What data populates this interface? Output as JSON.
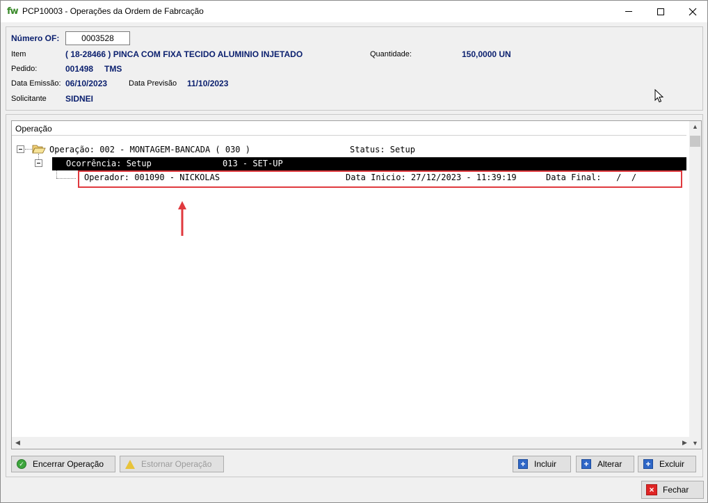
{
  "window": {
    "logo": "fw",
    "title": "PCP10003 - Operações da Ordem de Fabrcação"
  },
  "header": {
    "of_label": "Número OF:",
    "of_value": "0003528",
    "item_label": "Item",
    "item_value": "( 18-28466 ) PINCA COM FIXA TECIDO ALUMINIO INJETADO",
    "quantidade_label": "Quantidade:",
    "quantidade_value": "150,0000 UN",
    "pedido_label": "Pedido:",
    "pedido_value": "001498",
    "pedido_extra": "TMS",
    "emissao_label": "Data Emissão:",
    "emissao_value": "06/10/2023",
    "previsao_label": "Data Previsão",
    "previsao_value": "11/10/2023",
    "solicitante_label": "Solicitante",
    "solicitante_value": "SIDNEI"
  },
  "tree": {
    "header": "Operação",
    "operation_row": "Operação: 002 - MONTAGEM-BANCADA ( 030 )",
    "operation_status": "Status: Setup",
    "occurrence_row": "Ocorrência: Setup",
    "occurrence_code": "013 - SET-UP",
    "operator_row": "Operador: 001090 - NICKOLAS",
    "operator_inicio": "Data Inicio: 27/12/2023 - 11:39:19",
    "operator_final": "Data Final:   /  /"
  },
  "buttons": {
    "encerrar": "Encerrar Operação",
    "estornar": "Estornar Operação",
    "incluir": "Incluir",
    "alterar": "Alterar",
    "excluir": "Excluir",
    "fechar": "Fechar"
  },
  "colors": {
    "accent_text": "#0a1f6e",
    "selection_bg": "#000000",
    "annotation_red": "#e0393e"
  },
  "icons": {
    "encerrar": "check-circle-icon",
    "estornar": "warning-icon",
    "incluir": "plus-icon",
    "alterar": "plus-icon",
    "excluir": "plus-icon",
    "fechar": "close-x-icon",
    "tree_folder": "open-folder-icon"
  }
}
